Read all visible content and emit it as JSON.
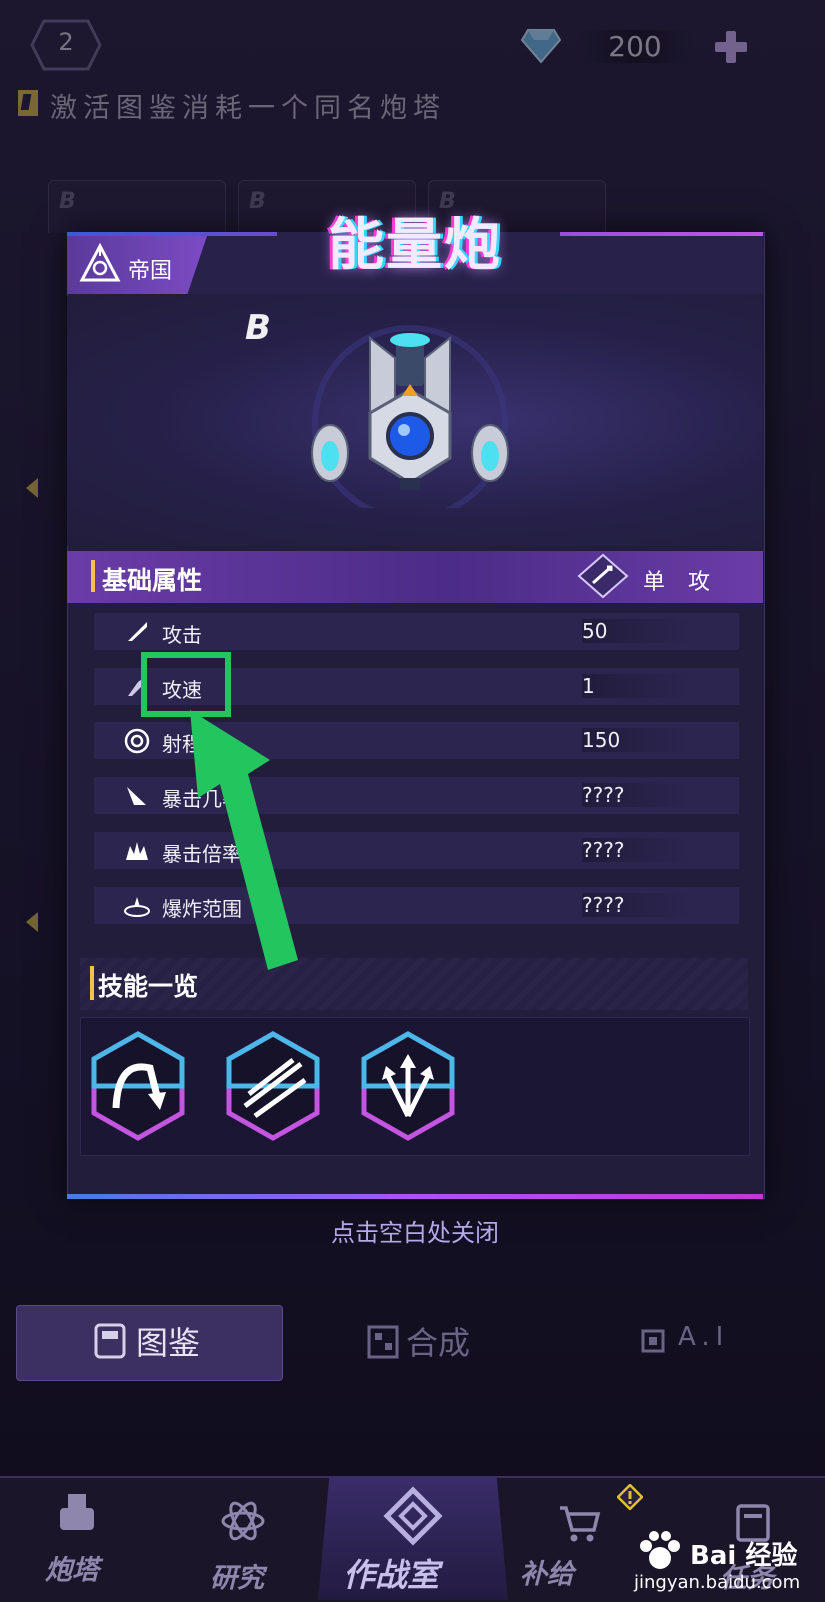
{
  "top_bar": {
    "level": "2",
    "gem_count": "200",
    "gem_icon": "diamond-icon",
    "add_icon": "plus-icon",
    "hint": "激活图鉴消耗一个同名炮塔"
  },
  "background_cards": [
    "B",
    "B",
    "B"
  ],
  "popup": {
    "faction_label": "帝国",
    "title": "能量炮",
    "grade": "B",
    "attributes_title": "基础属性",
    "attack_type": "单 攻",
    "attributes": [
      {
        "name": "攻击",
        "value": "50",
        "icon": "sword-icon"
      },
      {
        "name": "攻速",
        "value": "1",
        "icon": "speed-icon"
      },
      {
        "name": "射程",
        "value": "150",
        "icon": "target-icon"
      },
      {
        "name": "暴击几率",
        "value": "????",
        "icon": "crit-chance-icon"
      },
      {
        "name": "暴击倍率",
        "value": "????",
        "icon": "crit-multiplier-icon"
      },
      {
        "name": "爆炸范围",
        "value": "????",
        "icon": "explosion-icon"
      }
    ],
    "skills_title": "技能一览",
    "skills": [
      "skill-arc-icon",
      "skill-slash-icon",
      "skill-arrows-icon"
    ]
  },
  "close_hint": "点击空白处关闭",
  "tabs": [
    {
      "label": "图鉴",
      "icon": "book-icon",
      "active": true
    },
    {
      "label": "合成",
      "icon": "grid-icon",
      "active": false
    },
    {
      "label": "A.I",
      "icon": "chip-icon",
      "active": false
    }
  ],
  "bottom_nav": [
    {
      "label": "炮塔",
      "icon": "turret-icon"
    },
    {
      "label": "研究",
      "icon": "atom-icon"
    },
    {
      "label": "作战室",
      "icon": "diamond-frame-icon",
      "active": true
    },
    {
      "label": "补给",
      "icon": "cart-icon"
    },
    {
      "label": "任务",
      "icon": "mission-icon"
    }
  ],
  "watermark": {
    "text": "Bai 经验",
    "url": "jingyan.baidu.com"
  },
  "colors": {
    "accent_purple": "#7b4bc4",
    "highlight_green": "#22c55e",
    "gold": "#f2c24a"
  }
}
